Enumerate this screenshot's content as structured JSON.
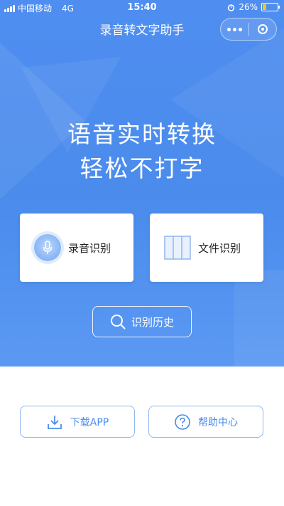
{
  "status_bar": {
    "carrier": "中国移动",
    "network": "4G",
    "time": "15:40",
    "battery_percent": "26%",
    "battery_level": 0.26
  },
  "nav": {
    "title": "录音转文字助手",
    "more_icon": "more-dots-icon",
    "close_icon": "target-close-icon"
  },
  "hero": {
    "line1": "语音实时转换",
    "line2": "轻松不打字"
  },
  "cards": {
    "record": {
      "label": "录音识别",
      "icon": "microphone-icon"
    },
    "file": {
      "label": "文件识别",
      "icon": "file-grid-icon"
    }
  },
  "history": {
    "label": "识别历史",
    "icon": "search-icon"
  },
  "bottom": {
    "download": {
      "label": "下载APP",
      "icon": "download-icon"
    },
    "help": {
      "label": "帮助中心",
      "icon": "help-circle-icon"
    }
  },
  "colors": {
    "primary_blue": "#4a8bec",
    "border_blue": "#8fb6ee",
    "battery_yellow": "#f5c518"
  }
}
